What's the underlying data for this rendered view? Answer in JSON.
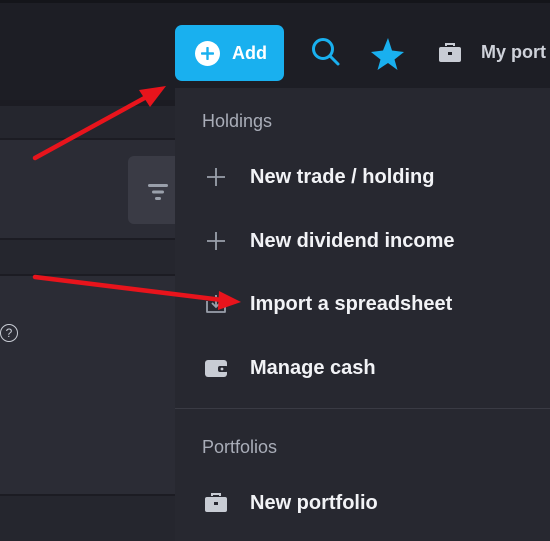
{
  "header": {
    "add_label": "Add",
    "portfolio_label": "My port"
  },
  "menu": {
    "holdings_heading": "Holdings",
    "holdings_items": [
      {
        "label": "New trade / holding",
        "icon": "plus-icon"
      },
      {
        "label": "New dividend income",
        "icon": "plus-icon"
      },
      {
        "label": "Import a spreadsheet",
        "icon": "import-icon"
      },
      {
        "label": "Manage cash",
        "icon": "wallet-icon"
      }
    ],
    "portfolios_heading": "Portfolios",
    "portfolio_items": [
      {
        "label": "New portfolio",
        "icon": "briefcase-icon"
      }
    ]
  },
  "background": {
    "help_symbol": "?"
  },
  "colors": {
    "accent": "#19b0ef",
    "annotation_arrow": "#e8141c",
    "menu_bg": "#272830"
  }
}
